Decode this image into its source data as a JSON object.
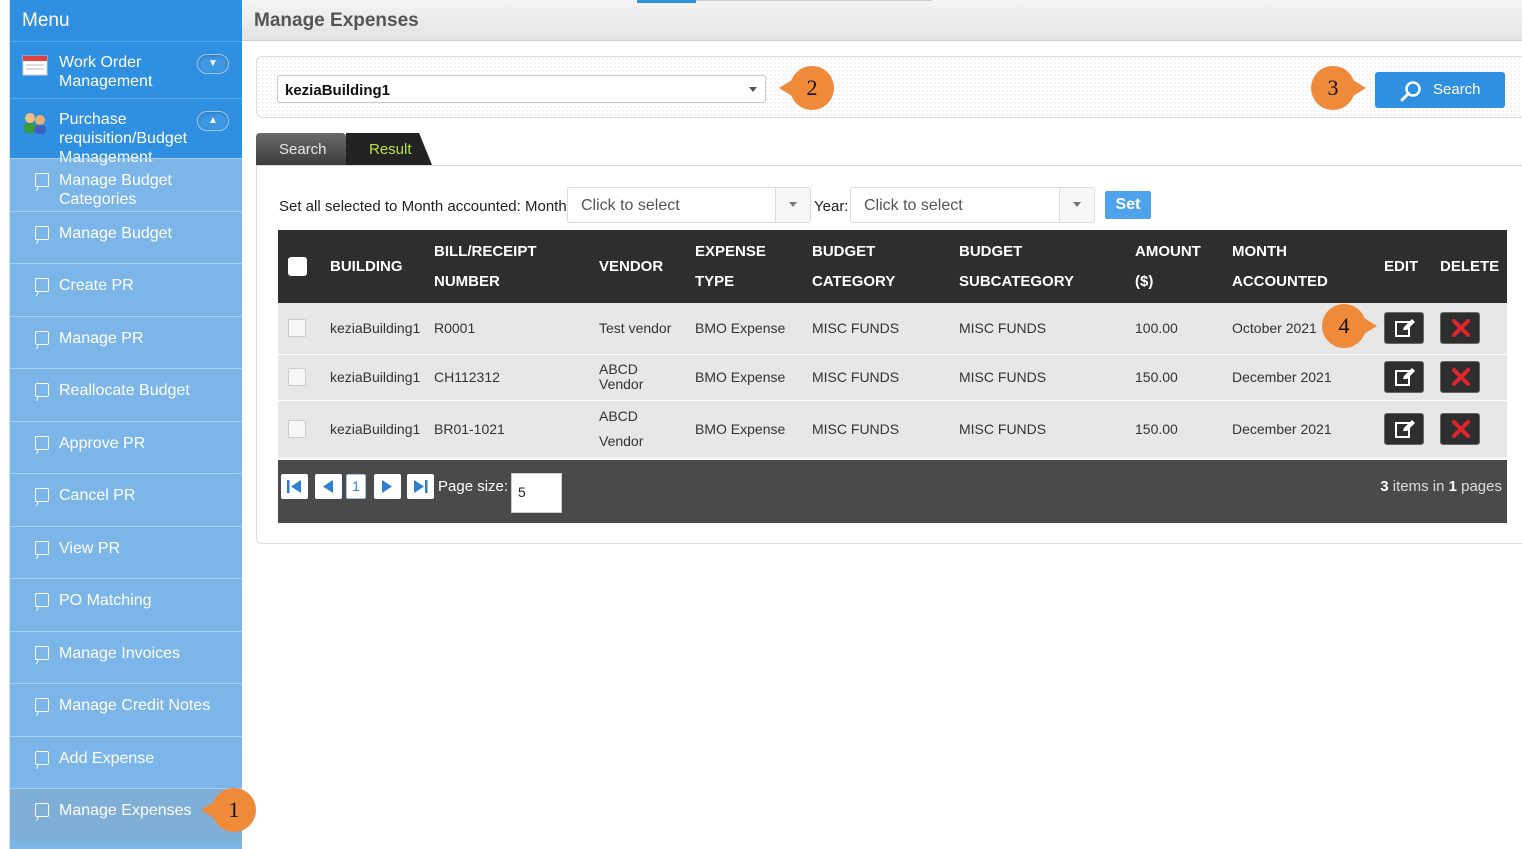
{
  "sidebar": {
    "title": "Menu",
    "groups": [
      {
        "label": "Work Order Management",
        "icon": "calendar-icon"
      },
      {
        "label": "Purchase requisition/Budget Management",
        "icon": "users-icon"
      }
    ],
    "items": [
      {
        "label": "Manage Budget Categories"
      },
      {
        "label": "Manage Budget"
      },
      {
        "label": "Create PR"
      },
      {
        "label": "Manage PR"
      },
      {
        "label": "Reallocate Budget"
      },
      {
        "label": "Approve PR"
      },
      {
        "label": "Cancel PR"
      },
      {
        "label": "View PR"
      },
      {
        "label": "PO Matching"
      },
      {
        "label": "Manage Invoices"
      },
      {
        "label": "Manage Credit Notes"
      },
      {
        "label": "Add Expense"
      },
      {
        "label": "Manage Expenses",
        "active": true
      }
    ]
  },
  "header": {
    "title": "Manage Expenses"
  },
  "filter": {
    "building_value": "keziaBuilding1",
    "search_label": "Search"
  },
  "tabs": [
    {
      "label": "Search"
    },
    {
      "label": "Result",
      "active": true
    }
  ],
  "set_row": {
    "label": "Set all selected to Month accounted: Month:",
    "month_placeholder": "Click to select",
    "year_label": "Year:",
    "year_placeholder": "Click to select",
    "set_label": "Set"
  },
  "table": {
    "headers": {
      "building": "BUILDING",
      "bill_1": "BILL/RECEIPT",
      "bill_2": "NUMBER",
      "vendor": "VENDOR",
      "exp_1": "EXPENSE",
      "exp_2": "TYPE",
      "bc_1": "BUDGET",
      "bc_2": "CATEGORY",
      "bs_1": "BUDGET",
      "bs_2": "SUBCATEGORY",
      "amt_1": "AMOUNT",
      "amt_2": "($)",
      "mon_1": "MONTH",
      "mon_2": "ACCOUNTED",
      "edit": "EDIT",
      "delete": "DELETE"
    },
    "rows": [
      {
        "building": "keziaBuilding1",
        "bill": "R0001",
        "vendor": "Test vendor",
        "expense_type": "BMO Expense",
        "category": "MISC FUNDS",
        "subcategory": "MISC FUNDS",
        "amount": "100.00",
        "month": "October 2021"
      },
      {
        "building": "keziaBuilding1",
        "bill": "CH112312",
        "vendor": "ABCD Vendor",
        "expense_type": "BMO Expense",
        "category": "MISC FUNDS",
        "subcategory": "MISC FUNDS",
        "amount": "150.00",
        "month": "December 2021"
      },
      {
        "building": "keziaBuilding1",
        "bill": "BR01-1021",
        "vendor": "ABCD Vendor",
        "expense_type": "BMO Expense",
        "category": "MISC FUNDS",
        "subcategory": "MISC FUNDS",
        "amount": "150.00",
        "month": "December 2021"
      }
    ]
  },
  "pager": {
    "current_page": "1",
    "page_size_label": "Page size:",
    "page_size": "5",
    "items_count": "3",
    "items_text": "items in",
    "pages_count": "1",
    "pages_text": "pages"
  },
  "annotations": [
    "1",
    "2",
    "3",
    "4"
  ],
  "colors": {
    "accent": "#2f8fe0",
    "marker": "#ee8a3a",
    "grid_header": "#2e2e2e",
    "delete_icon": "#e0242b"
  }
}
